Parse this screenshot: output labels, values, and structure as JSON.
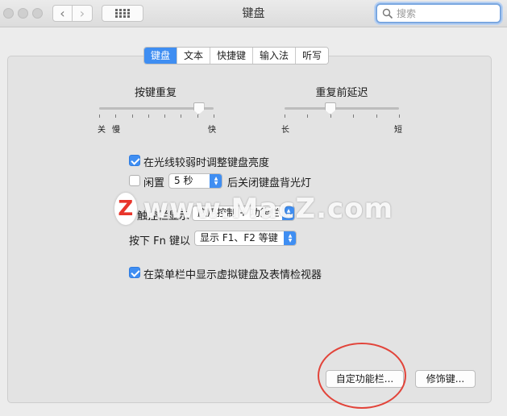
{
  "window": {
    "title": "键盘"
  },
  "search": {
    "placeholder": "搜索"
  },
  "tabs": [
    {
      "label": "键盘",
      "active": true
    },
    {
      "label": "文本",
      "active": false
    },
    {
      "label": "快捷键",
      "active": false
    },
    {
      "label": "输入法",
      "active": false
    },
    {
      "label": "听写",
      "active": false
    }
  ],
  "key_repeat": {
    "label": "按键重复",
    "left": "关",
    "left2": "慢",
    "right": "快",
    "level": 0.87
  },
  "delay_until_repeat": {
    "label": "重复前延迟",
    "left": "长",
    "right": "短",
    "level": 0.4
  },
  "options": {
    "adjust_brightness": {
      "label": "在光线较弱时调整键盘亮度",
      "checked": true
    },
    "idle_prefix": "闲置",
    "idle_checked": false,
    "idle_value": "5 秒",
    "idle_suffix": "后关闭键盘背光灯",
    "touchbar_label": "触控栏显示",
    "touchbar_value": "应用控制 + 功能栏",
    "fn_label": "按下 Fn 键以",
    "fn_value": "显示 F1、F2 等键",
    "show_viewer": {
      "label": "在菜单栏中显示虚拟键盘及表情检视器",
      "checked": true
    }
  },
  "buttons": {
    "customize": "自定功能栏...",
    "modifier": "修饰键..."
  },
  "watermark": {
    "logo": "Z",
    "text": "www.MacZ.com"
  },
  "colors": {
    "accent": "#3f8ef2",
    "annotation": "#e2443a"
  }
}
